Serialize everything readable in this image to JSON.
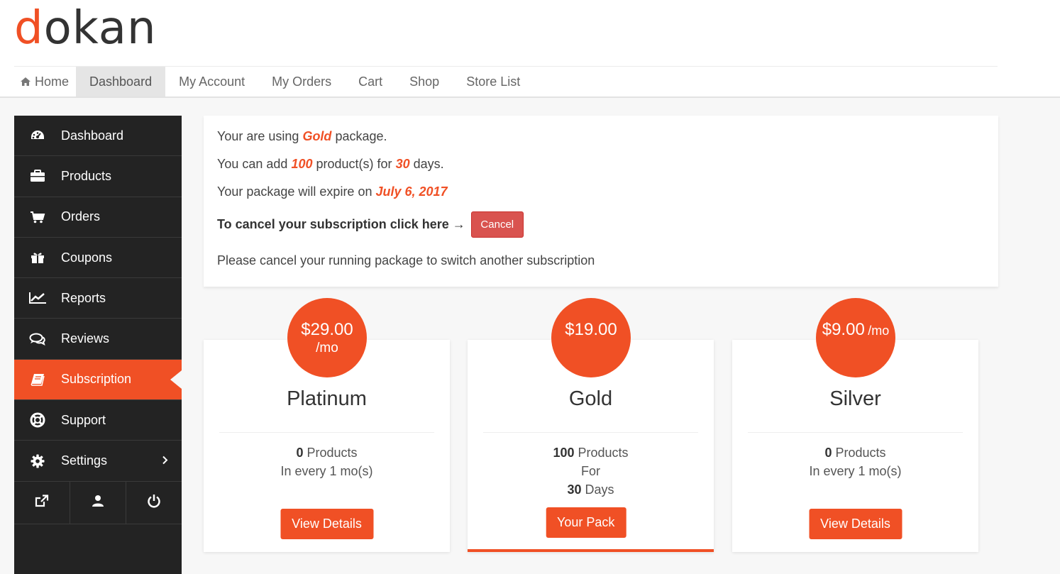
{
  "logo": {
    "first": "d",
    "rest": "okan"
  },
  "nav": {
    "items": [
      {
        "label": "Home",
        "icon": "home-icon"
      },
      {
        "label": "Dashboard",
        "active": true
      },
      {
        "label": "My Account"
      },
      {
        "label": "My Orders"
      },
      {
        "label": "Cart"
      },
      {
        "label": "Shop"
      },
      {
        "label": "Store List"
      }
    ]
  },
  "sidebar": {
    "items": [
      {
        "label": "Dashboard",
        "icon": "dashboard-gauge-icon"
      },
      {
        "label": "Products",
        "icon": "briefcase-icon"
      },
      {
        "label": "Orders",
        "icon": "cart-icon"
      },
      {
        "label": "Coupons",
        "icon": "gift-icon"
      },
      {
        "label": "Reports",
        "icon": "line-chart-icon"
      },
      {
        "label": "Reviews",
        "icon": "comments-icon"
      },
      {
        "label": "Subscription",
        "icon": "book-icon",
        "active": true
      },
      {
        "label": "Support",
        "icon": "life-ring-icon"
      },
      {
        "label": "Settings",
        "icon": "gear-icon"
      }
    ],
    "footer_icons": [
      "external-link-icon",
      "user-icon",
      "power-icon"
    ]
  },
  "info": {
    "line1_pre": "Your are using",
    "package": "Gold",
    "line1_post": "package.",
    "line2_pre": "You can add",
    "products": "100",
    "line2_mid": "product(s) for",
    "days": "30",
    "line2_post": "days.",
    "line3_pre": "Your package will expire on",
    "expire": "July 6, 2017",
    "cancel_text": "To cancel your subscription click here →",
    "cancel_label": "Cancel",
    "note": "Please cancel your running package to switch another subscription"
  },
  "packs": [
    {
      "price": "$29.00",
      "per": "/mo",
      "name": "Platinum",
      "count": "0",
      "count_label": "Products",
      "line2": "In every 1 mo(s)",
      "button": "View Details"
    },
    {
      "price": "$19.00",
      "name": "Gold",
      "count": "100",
      "count_label": "Products",
      "line2": "For",
      "days": "30",
      "days_label": "Days",
      "button": "Your Pack"
    },
    {
      "price": "$9.00",
      "per": "/mo",
      "name": "Silver",
      "count": "0",
      "count_label": "Products",
      "line2": "In every 1 mo(s)",
      "button": "View Details"
    }
  ],
  "colors": {
    "accent": "#f05025",
    "cancel": "#d9534f",
    "sidebar": "#232323"
  }
}
